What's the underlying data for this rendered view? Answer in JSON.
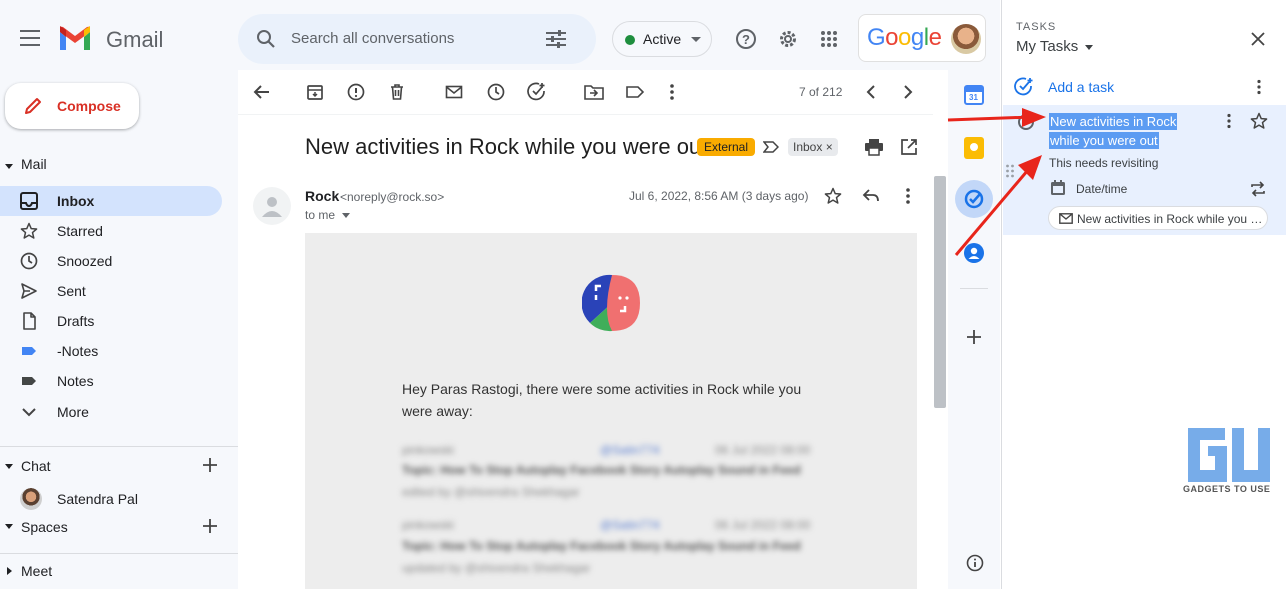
{
  "app": {
    "name": "Gmail"
  },
  "header": {
    "search_placeholder": "Search all conversations",
    "status_label": "Active",
    "brand": "Google"
  },
  "compose_label": "Compose",
  "nav": {
    "mail_section": "Mail",
    "items": [
      {
        "label": "Inbox",
        "icon": "inbox-icon",
        "active": true
      },
      {
        "label": "Starred",
        "icon": "star-icon"
      },
      {
        "label": "Snoozed",
        "icon": "clock-icon"
      },
      {
        "label": "Sent",
        "icon": "send-icon"
      },
      {
        "label": "Drafts",
        "icon": "draft-icon"
      },
      {
        "label": "-Notes",
        "icon": "label-icon",
        "color": "#4285f4"
      },
      {
        "label": "Notes",
        "icon": "label-icon",
        "color": "#444746"
      },
      {
        "label": "More",
        "icon": "chevron-down-icon"
      }
    ],
    "chat_section": "Chat",
    "chat_contact": "Satendra Pal",
    "spaces_section": "Spaces",
    "meet_section": "Meet"
  },
  "toolbar": {
    "pagination": "7 of 212"
  },
  "email": {
    "subject": "New activities in Rock while you were out",
    "external_badge": "External",
    "inbox_label": "Inbox",
    "sender_name": "Rock",
    "sender_email": "<noreply@rock.so>",
    "date": "Jul 6, 2022, 8:56 AM (3 days ago)",
    "to": "to me",
    "greeting": "Hey Paras Rastogi, there were some activities in Rock while you were away:",
    "blurred_rows": [
      {
        "a": "pinkowski",
        "b": "@Satin774",
        "c": "06 Jul 2022 08:00",
        "title": "Topic: How To Stop Autoplay Facebook Story Autoplay Sound in Feed",
        "sub": "edited by @shivendra Shekhagar"
      },
      {
        "a": "pinkowski",
        "b": "@Satin774",
        "c": "06 Jul 2022 08:00",
        "title": "Topic: How To Stop Autoplay Facebook Story Autoplay Sound in Feed",
        "sub": "updated by @shivendra Shekhagar"
      }
    ]
  },
  "tasks": {
    "panel_label": "TASKS",
    "list_name": "My Tasks",
    "add_task": "Add a task",
    "task_title_line1": "New activities in Rock",
    "task_title_line2": "while you were out",
    "task_details": "This needs revisiting",
    "date_time": "Date/time",
    "linked_email": "New activities in Rock while you w..."
  },
  "watermark": {
    "text": "GADGETS TO USE"
  },
  "colors": {
    "accent": "#0b57d0",
    "compose_red": "#d93025",
    "external_badge": "#f9ab00",
    "annotation_arrow": "#e8251b"
  }
}
